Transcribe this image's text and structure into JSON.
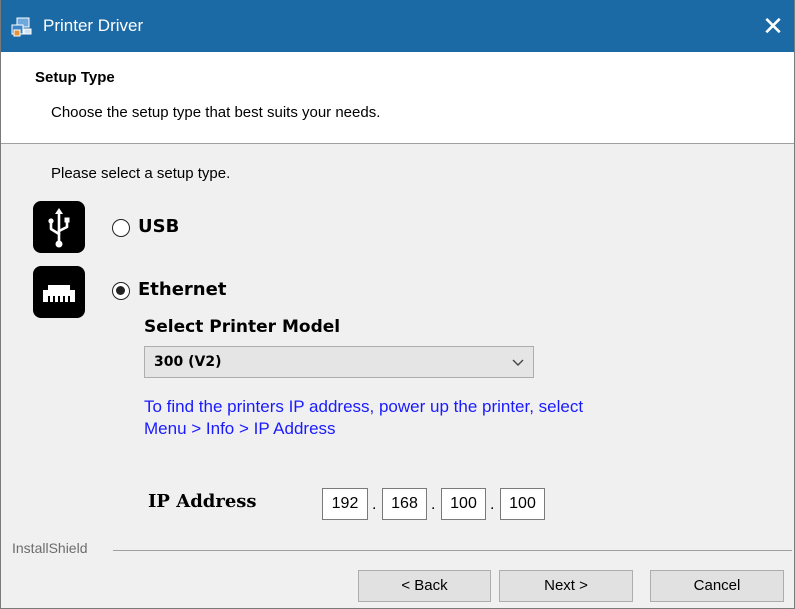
{
  "window": {
    "title": "Printer Driver",
    "close_glyph": "✕",
    "icon": "installer-icon"
  },
  "header": {
    "title": "Setup Type",
    "subtitle": "Choose the setup type that best suits your needs."
  },
  "prompt": "Please select a setup type.",
  "options": [
    {
      "label": "USB",
      "icon": "usb-icon",
      "selected": false
    },
    {
      "label": "Ethernet",
      "icon": "ethernet-icon",
      "selected": true
    }
  ],
  "model": {
    "label": "Select Printer Model",
    "selected": "300 (V2)"
  },
  "hint": {
    "line1": "To find the printers IP address, power up the printer, select",
    "line2": "Menu > Info > IP Address",
    "color": "#1a1aff"
  },
  "ip": {
    "label": "IP Address",
    "octets": [
      "192",
      "168",
      "100",
      "100"
    ],
    "separator": "."
  },
  "footer": {
    "brand": "InstallShield",
    "back": "< Back",
    "next": "Next >",
    "cancel": "Cancel"
  },
  "colors": {
    "titlebar": "#1c6aa5",
    "background": "#f0f0f0"
  }
}
